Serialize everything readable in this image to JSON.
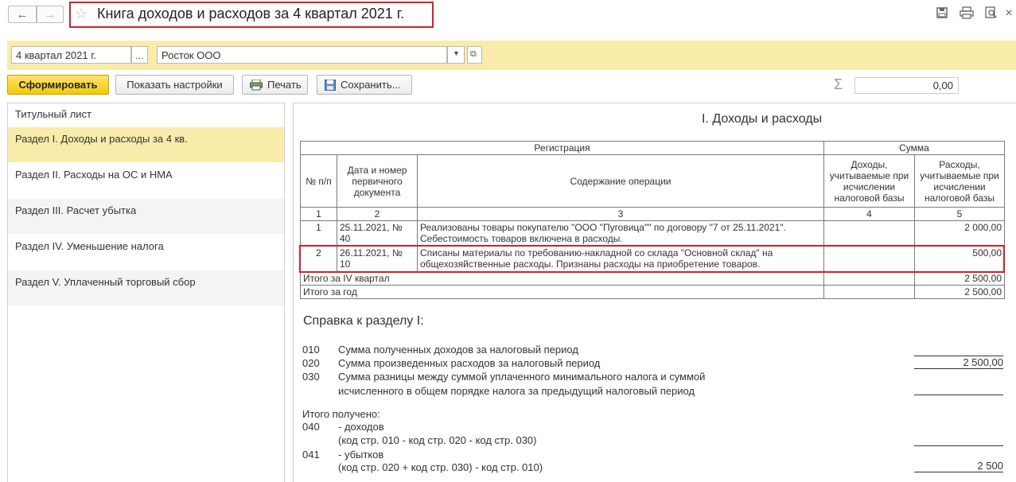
{
  "header": {
    "title": "Книга доходов и расходов за 4 квартал 2021 г.",
    "back_icon": "←",
    "forward_icon": "→"
  },
  "filters": {
    "period": "4 квартал 2021 г.",
    "period_btn": "...",
    "org": "Росток ООО"
  },
  "toolbar": {
    "generate": "Сформировать",
    "show_settings": "Показать настройки",
    "print": "Печать",
    "save": "Сохранить...",
    "sum_value": "0,00"
  },
  "sidebar": {
    "items": [
      "Титульный лист",
      "Раздел I. Доходы и расходы за 4 кв.",
      "Раздел II. Расходы на ОС и НМА",
      "Раздел III. Расчет убытка",
      "Раздел IV. Уменьшение налога",
      "Раздел V. Уплаченный торговый сбор"
    ],
    "selected_index": 1
  },
  "report": {
    "section_title": "I. Доходы и расходы",
    "headers": {
      "registration": "Регистрация",
      "sum": "Сумма",
      "num": "№ п/п",
      "date_doc": "Дата и номер первичного документа",
      "content": "Содержание операции",
      "income": "Доходы, учитываемые при исчислении налоговой базы",
      "expense": "Расходы, учитываемые при исчислении налоговой базы"
    },
    "col_nums": [
      "1",
      "2",
      "3",
      "4",
      "5"
    ],
    "rows": [
      {
        "num": "1",
        "date": "25.11.2021, № 40",
        "content": "Реализованы товары покупателю \"ООО \"Пуговица\"\" по договору \"7 от 25.11.2021\". Себестоимость товаров включена в расходы.",
        "income": "",
        "expense": "2 000,00"
      },
      {
        "num": "2",
        "date": "26.11.2021, № 10",
        "content": "Списаны материалы по требованию-накладной со склада \"Основной склад\" на общехозяйственные расходы. Признаны расходы на приобретение товаров.",
        "income": "",
        "expense": "500,00"
      }
    ],
    "total_quarter_label": "Итого за IV квартал",
    "total_quarter_expense": "2 500,00",
    "total_year_label": "Итого за год",
    "total_year_expense": "2 500,00",
    "ref_title": "Справка к разделу I:",
    "ref_lines": [
      {
        "code": "010",
        "text": "Сумма полученных доходов за налоговый период",
        "value": ""
      },
      {
        "code": "020",
        "text": "Сумма произведенных  расходов за налоговый период",
        "value": "2 500,00"
      },
      {
        "code": "030",
        "text": "Сумма разницы между  суммой уплаченного минимального налога и суммой",
        "value": ""
      },
      {
        "code": "",
        "text": "исчисленного в общем порядке налога за предыдущий налоговый период",
        "value": ""
      }
    ],
    "received_label": "Итого получено:",
    "l040_code": "040",
    "l040_a": "- доходов",
    "l040_b": "(код стр. 010 - код  стр. 020 - код стр. 030)",
    "l040_value": "",
    "l041_code": "041",
    "l041_a": "- убытков",
    "l041_b": "(код стр. 020 + код  стр. 030) - код стр. 010)",
    "l041_value": "2 500"
  }
}
